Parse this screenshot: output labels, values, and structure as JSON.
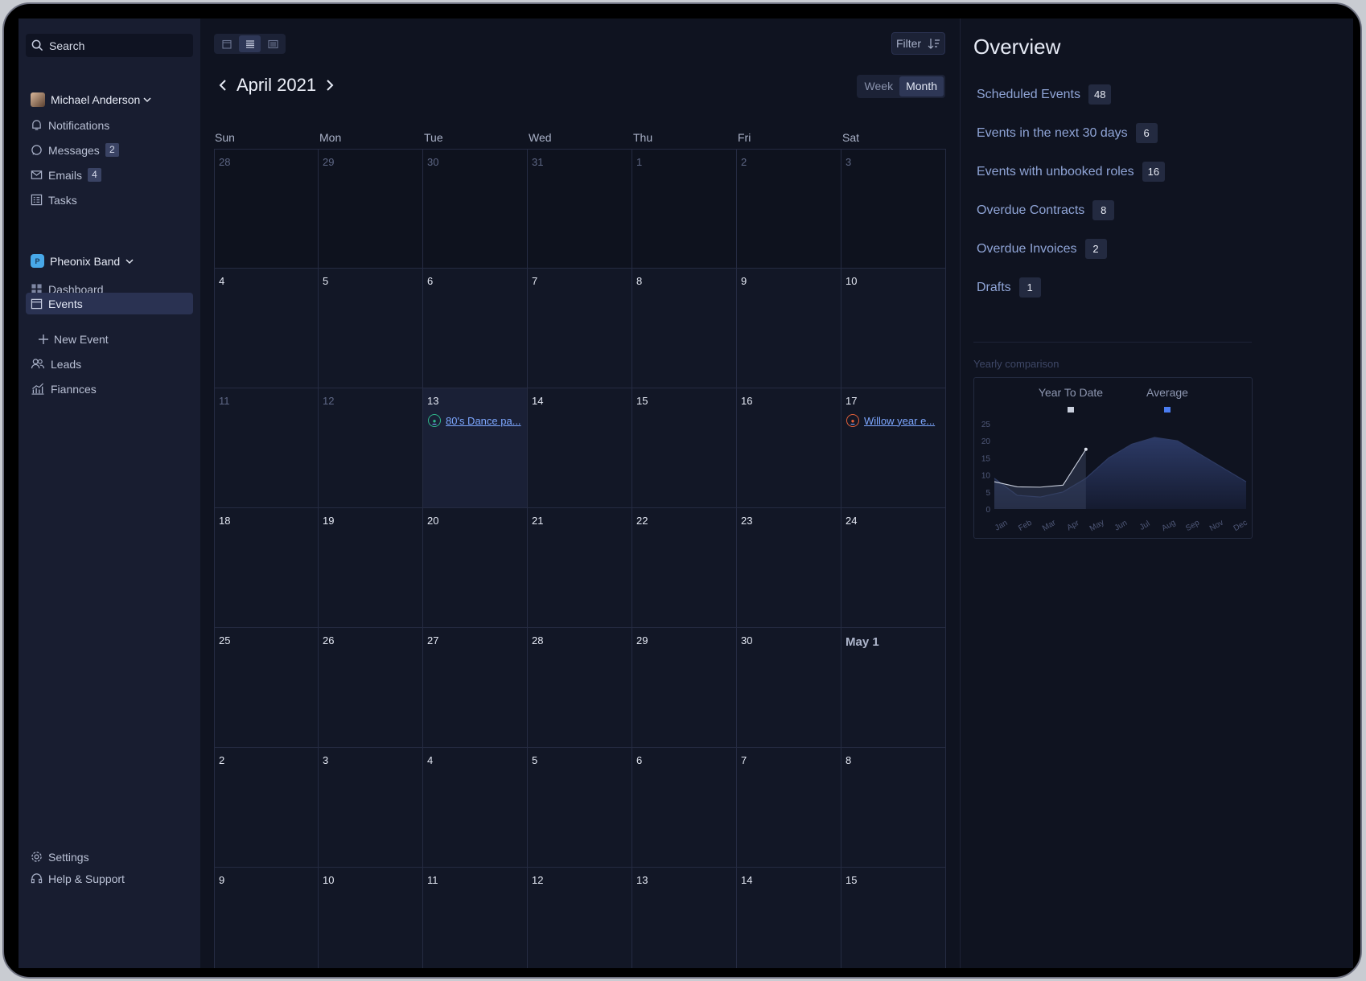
{
  "sidebar": {
    "search_placeholder": "Search",
    "user": {
      "name": "Michael Anderson"
    },
    "personal_items": [
      {
        "label": "Notifications",
        "icon": "bell-icon",
        "badge": ""
      },
      {
        "label": "Messages",
        "icon": "message-icon",
        "badge": "2"
      },
      {
        "label": "Emails",
        "icon": "mail-icon",
        "badge": "4"
      },
      {
        "label": "Tasks",
        "icon": "tasks-icon",
        "badge": ""
      }
    ],
    "workspace": {
      "name": "Pheonix Band",
      "logo_letter": "P"
    },
    "workspace_items": [
      {
        "label": "Dashboard",
        "icon": "dashboard-icon",
        "active": false
      },
      {
        "label": "Events",
        "icon": "calendar-icon",
        "active": true
      },
      {
        "label": "New Event",
        "icon": "plus-icon",
        "active": false
      },
      {
        "label": "Leads",
        "icon": "users-icon",
        "active": false
      },
      {
        "label": "Fiannces",
        "icon": "chart-icon",
        "active": false
      }
    ],
    "footer_items": [
      {
        "label": "Settings",
        "icon": "gear-icon"
      },
      {
        "label": "Help & Support",
        "icon": "headset-icon"
      }
    ]
  },
  "calendar": {
    "view_buttons": [
      "calendar-view-icon",
      "list-view-icon",
      "table-view-icon"
    ],
    "active_view": 1,
    "filter_label": "Filter",
    "month_title": "April 2021",
    "range_buttons": [
      "Week",
      "Month"
    ],
    "active_range": "Month",
    "weekdays": [
      "Sun",
      "Mon",
      "Tue",
      "Wed",
      "Thu",
      "Fri",
      "Sat"
    ],
    "weeks": [
      [
        "28",
        "29",
        "30",
        "31",
        "1",
        "2",
        "3"
      ],
      [
        "4",
        "5",
        "6",
        "7",
        "8",
        "9",
        "10"
      ],
      [
        "11",
        "12",
        "13",
        "14",
        "15",
        "16",
        "17"
      ],
      [
        "18",
        "19",
        "20",
        "21",
        "22",
        "23",
        "24"
      ],
      [
        "25",
        "26",
        "27",
        "28",
        "29",
        "30",
        "May 1"
      ],
      [
        "2",
        "3",
        "4",
        "5",
        "6",
        "7",
        "8"
      ],
      [
        "9",
        "10",
        "11",
        "12",
        "13",
        "14",
        "15"
      ]
    ],
    "events": [
      {
        "week": 2,
        "day": 2,
        "title": "80's Dance pa...",
        "color": "#2fb58a"
      },
      {
        "week": 2,
        "day": 6,
        "title": "Willow year e...",
        "color": "#e2603a"
      }
    ]
  },
  "overview": {
    "title": "Overview",
    "stats": [
      {
        "label": "Scheduled Events",
        "value": "48"
      },
      {
        "label": "Events in the next 30 days",
        "value": "6"
      },
      {
        "label": "Events with unbooked roles",
        "value": "16"
      },
      {
        "label": "Overdue Contracts",
        "value": "8"
      },
      {
        "label": "Overdue Invoices",
        "value": "2"
      },
      {
        "label": "Drafts",
        "value": "1"
      }
    ],
    "yearly_label": "Yearly comparison"
  },
  "chart_data": {
    "type": "area",
    "title": "",
    "x": [
      "Jan",
      "Feb",
      "Mar",
      "Apr",
      "May",
      "Jun",
      "Jul",
      "Aug",
      "Sep",
      "Nov",
      "Dec"
    ],
    "y_ticks": [
      0,
      5,
      10,
      15,
      20,
      25
    ],
    "ylim": [
      0,
      25
    ],
    "legend_position": "top",
    "series": [
      {
        "name": "Year To Date",
        "color": "#c9cfdd",
        "values": [
          8,
          6.5,
          6.4,
          7,
          17.5
        ]
      },
      {
        "name": "Average",
        "color": "#4a7cf0",
        "values": [
          9,
          4,
          3.5,
          5,
          9,
          15,
          19,
          21,
          20,
          16,
          12,
          8
        ]
      }
    ]
  }
}
